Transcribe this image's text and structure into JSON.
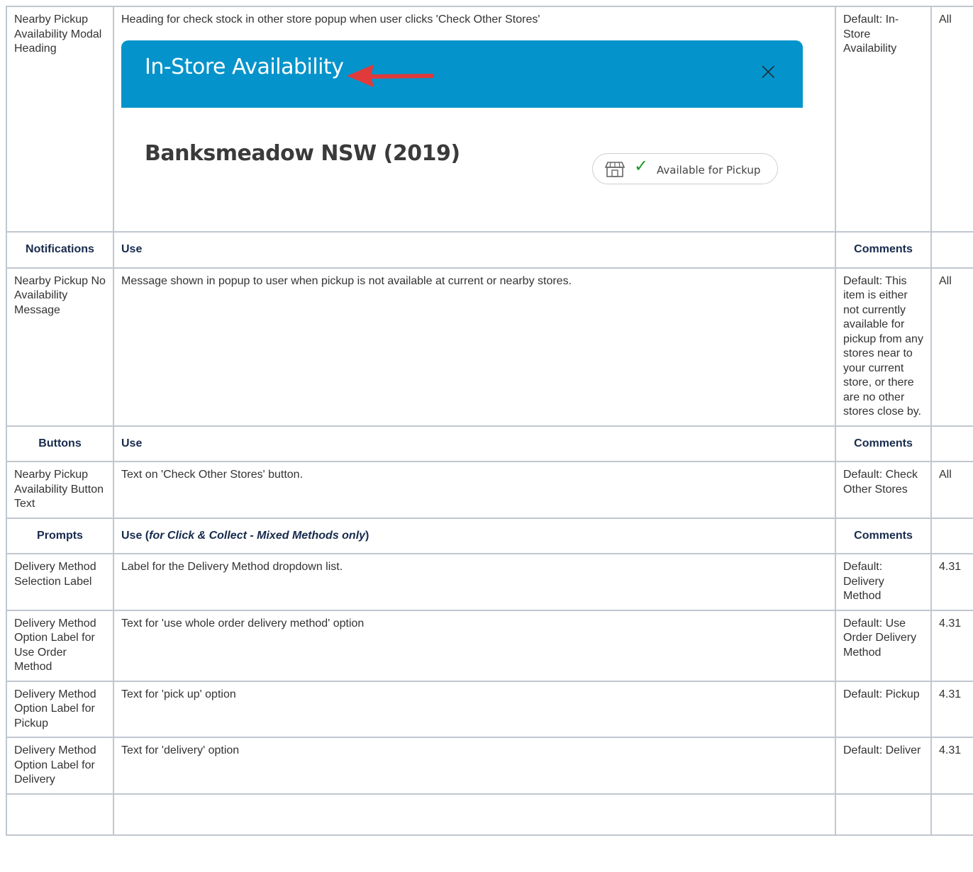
{
  "rows": [
    {
      "name": "Nearby Pickup Availability Modal Heading",
      "use": "Heading for check stock in other store popup when user clicks 'Check Other Stores'",
      "comment": "Default: In-Store Availability",
      "version": "All",
      "mock": {
        "title": "In-Store Availability",
        "close": "×",
        "store": "Banksmeadow NSW (2019)",
        "pill_label": "Available for Pickup",
        "tick": "✓"
      }
    }
  ],
  "section_notifications": {
    "label": "Notifications",
    "use": "Use",
    "comments": "Comments"
  },
  "row_no_availability": {
    "name": "Nearby Pickup No Availability Message",
    "use": "Message shown in popup to user when pickup is not available at current or nearby stores.",
    "comment": "Default: This item is either not currently available for pickup from any stores near to your current store, or there are no other stores close by.",
    "version": "All"
  },
  "section_buttons": {
    "label": "Buttons",
    "use": "Use",
    "comments": "Comments"
  },
  "row_button_text": {
    "name": "Nearby Pickup Availability Button Text",
    "use": "Text on 'Check Other Stores' button.",
    "comment": "Default: Check Other Stores",
    "version": "All"
  },
  "section_prompts": {
    "label": "Prompts",
    "use_prefix": "Use (",
    "use_em": "for Click & Collect - Mixed Methods only",
    "use_suffix": ")",
    "comments": "Comments"
  },
  "prompt_rows": [
    {
      "name": "Delivery Method Selection Label",
      "use": "Label for the Delivery Method dropdown list.",
      "comment": "Default: Delivery Method",
      "version": "4.31"
    },
    {
      "name": "Delivery Method Option Label for Use Order Method",
      "use": "Text for 'use whole order delivery method' option",
      "comment": "Default: Use Order Delivery Method",
      "version": "4.31"
    },
    {
      "name": "Delivery Method Option Label for Pickup",
      "use": "Text for 'pick up' option",
      "comment": "Default: Pickup",
      "version": "4.31"
    },
    {
      "name": "Delivery Method Option Label for Delivery",
      "use": "Text for 'delivery' option",
      "comment": "Default: Deliver",
      "version": "4.31"
    }
  ]
}
